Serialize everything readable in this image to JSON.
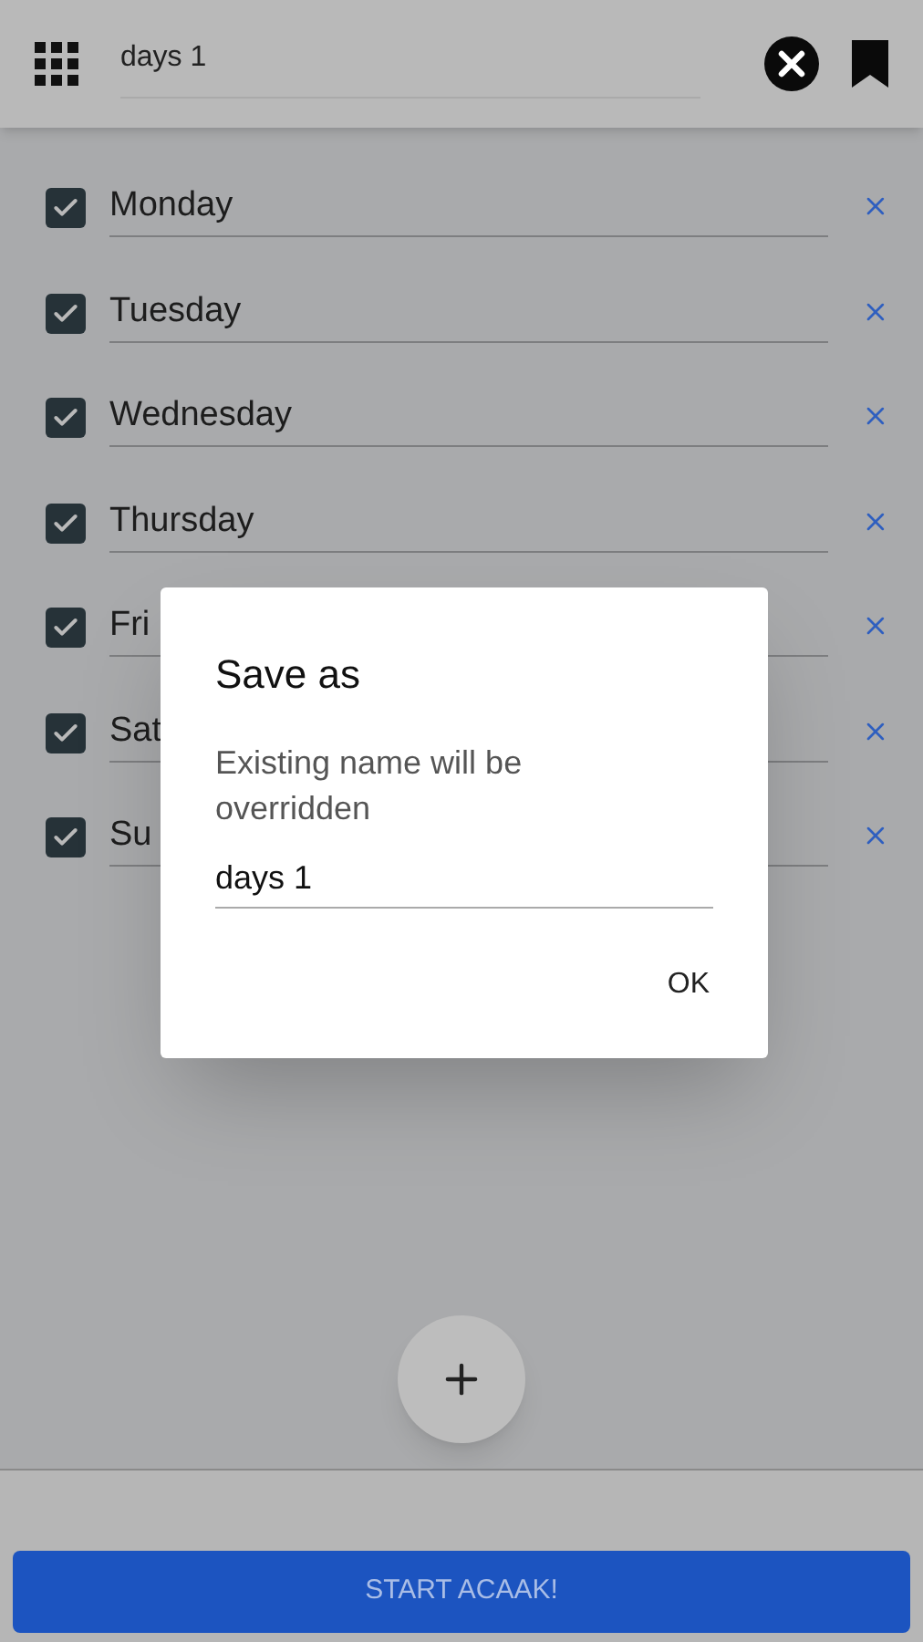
{
  "header": {
    "title": "days 1"
  },
  "days": [
    {
      "label": "Monday",
      "checked": true
    },
    {
      "label": "Tuesday",
      "checked": true
    },
    {
      "label": "Wednesday",
      "checked": true
    },
    {
      "label": "Thursday",
      "checked": true
    },
    {
      "label": "Fri",
      "checked": true
    },
    {
      "label": "Sat",
      "checked": true
    },
    {
      "label": "Su",
      "checked": true
    }
  ],
  "dialog": {
    "title": "Save as",
    "message": "Existing name will be overridden",
    "value": "days 1",
    "button": "OK"
  },
  "start_button": "START ACAAK!"
}
